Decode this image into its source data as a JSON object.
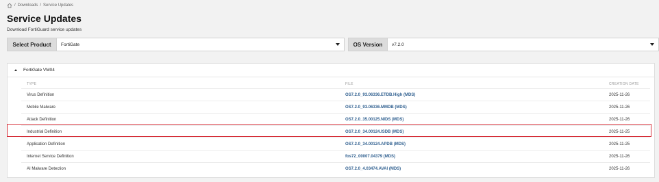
{
  "breadcrumb": {
    "items": [
      "Downloads",
      "Service Updates"
    ],
    "sep": "/"
  },
  "page": {
    "title": "Service Updates",
    "subtitle": "Download FortiGuard service updates"
  },
  "selectors": {
    "product_label": "Select Product",
    "product_value": "FortiGate",
    "os_label": "OS Version",
    "os_value": "v7.2.0"
  },
  "panel": {
    "title": "FortiGate VM04"
  },
  "table": {
    "headers": {
      "type": "TYPE",
      "file": "FILE",
      "date": "CREATION DATE"
    },
    "rows": [
      {
        "type": "Virus Definition",
        "file": "OS7.2.0_93.06336.ETDB.High (MDS)",
        "date": "2025-11-26"
      },
      {
        "type": "Mobile Malware",
        "file": "OS7.2.0_93.06336.MMDB (MDS)",
        "date": "2025-11-26"
      },
      {
        "type": "Attack Definition",
        "file": "OS7.2.0_35.00125.NIDS (MDS)",
        "date": "2025-11-26"
      },
      {
        "type": "Industrial Definition",
        "file": "OS7.2.0_34.00124.ISDB (MDS)",
        "date": "2025-11-25"
      },
      {
        "type": "Application Definition",
        "file": "OS7.2.0_34.00124.APDB (MDS)",
        "date": "2025-11-25"
      },
      {
        "type": "Internet Service Definition",
        "file": "fos72_00007.04379 (MDS)",
        "date": "2025-11-26"
      },
      {
        "type": "AI Malware Detection",
        "file": "OS7.2.0_4.03474.AVAI (MDS)",
        "date": "2025-11-26"
      }
    ]
  },
  "colors": {
    "highlight": "#d6303a",
    "link": "#2f5f8f"
  }
}
